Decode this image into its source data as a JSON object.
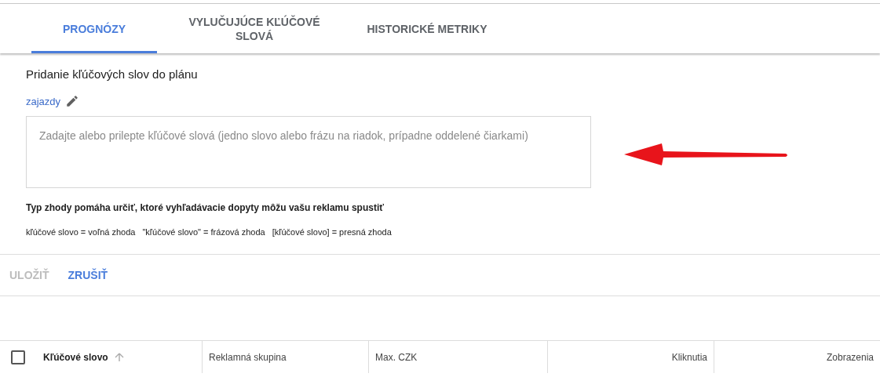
{
  "tabs": [
    {
      "label": "PROGNÓZY",
      "selected": true
    },
    {
      "label": "VYLUČUJÚCE KĽÚČOVÉ SLOVÁ",
      "selected": false
    },
    {
      "label": "HISTORICKÉ METRIKY",
      "selected": false
    }
  ],
  "form": {
    "title": "Pridanie kľúčových slov do plánu",
    "ad_group": "zajazdy",
    "keywords_field": {
      "placeholder": "Zadajte alebo prilepte kľúčové slová (jedno slovo alebo frázu na riadok, prípadne oddelené čiarkami)"
    },
    "match_help_title": "Typ zhody pomáha určiť, ktoré vyhľadávacie dopyty môžu vašu reklamu spustiť",
    "match_types": [
      "kľúčové slovo = voľná zhoda",
      "\"kľúčové slovo\" = frázová zhoda",
      "[kľúčové slovo] = presná zhoda"
    ]
  },
  "buttons": [
    {
      "label": "ULOŽIŤ",
      "disabled": true
    },
    {
      "label": "ZRUŠIŤ",
      "disabled": false
    }
  ],
  "table": {
    "select_all": {
      "checked": false
    },
    "columns": [
      {
        "label": "Kľúčové slovo",
        "sorted": true
      },
      {
        "label": "Reklamná skupina",
        "sorted": false
      },
      {
        "label": "Max. CZK",
        "sorted": false
      },
      {
        "label": "Kliknutia",
        "sorted": false
      },
      {
        "label": "Zobrazenia",
        "sorted": false
      }
    ]
  }
}
